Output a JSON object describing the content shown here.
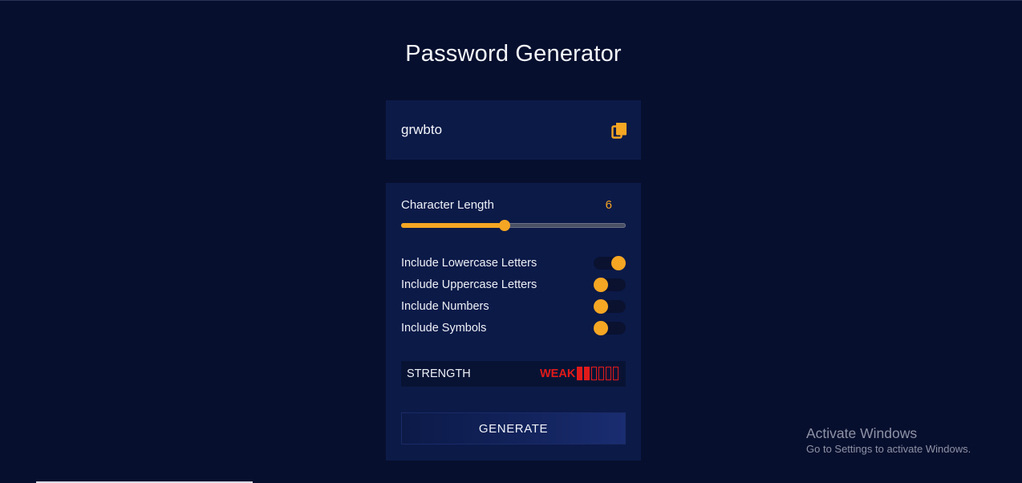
{
  "app": {
    "title": "Password Generator"
  },
  "output": {
    "password": "grwbto",
    "copy_icon": "copy-icon"
  },
  "length": {
    "label": "Character Length",
    "value": "6",
    "slider_fraction": 0.46
  },
  "options": [
    {
      "label": "Include Lowercase Letters",
      "checked": true
    },
    {
      "label": "Include Uppercase Letters",
      "checked": false
    },
    {
      "label": "Include Numbers",
      "checked": false
    },
    {
      "label": "Include Symbols",
      "checked": false
    }
  ],
  "strength": {
    "label": "STRENGTH",
    "value": "WEAK",
    "filled_bars": 2,
    "total_bars": 6
  },
  "generate": {
    "label": "GENERATE"
  },
  "watermark": {
    "title": "Activate Windows",
    "subtitle": "Go to Settings to activate Windows."
  },
  "colors": {
    "background": "#070f2e",
    "panel": "#0c1a48",
    "accent": "#f5a623",
    "weak": "#e01a1a"
  }
}
